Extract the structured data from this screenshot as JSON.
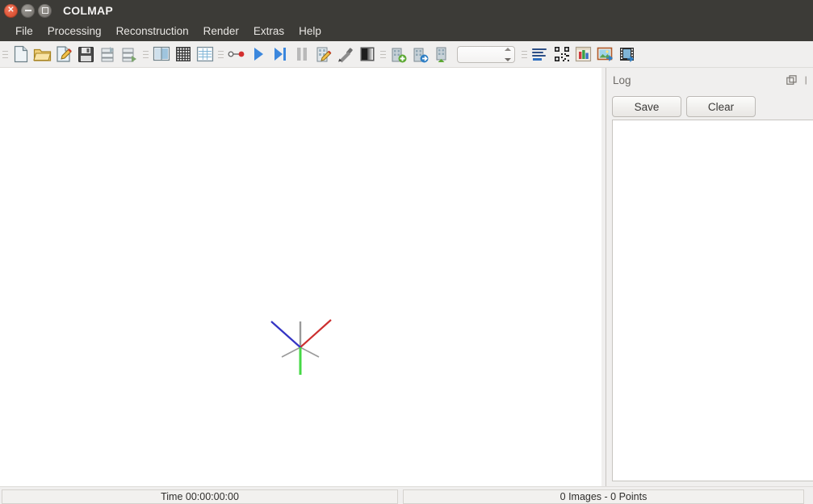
{
  "window": {
    "title": "COLMAP",
    "controls": [
      {
        "name": "close",
        "glyph": "×"
      },
      {
        "name": "minimize",
        "glyph": "−"
      },
      {
        "name": "maximize",
        "glyph": "□"
      }
    ]
  },
  "menubar": {
    "items": [
      {
        "label": "File"
      },
      {
        "label": "Processing"
      },
      {
        "label": "Reconstruction"
      },
      {
        "label": "Render"
      },
      {
        "label": "Extras"
      },
      {
        "label": "Help"
      }
    ]
  },
  "toolbar": {
    "spinbox": {
      "value": "",
      "placeholder": ""
    },
    "groups": [
      {
        "name": "project-group",
        "buttons": [
          {
            "icon": "new-project-icon",
            "tooltip": "New project"
          },
          {
            "icon": "open-project-icon",
            "tooltip": "Open project"
          },
          {
            "icon": "edit-project-icon",
            "tooltip": "Edit project"
          },
          {
            "icon": "save-project-icon",
            "tooltip": "Save project"
          },
          {
            "icon": "import-model-icon",
            "tooltip": "Import model"
          },
          {
            "icon": "export-model-icon",
            "tooltip": "Export model"
          }
        ]
      },
      {
        "name": "feature-group",
        "buttons": [
          {
            "icon": "feature-extraction-icon",
            "tooltip": "Feature extraction"
          },
          {
            "icon": "feature-matching-icon",
            "tooltip": "Feature matching"
          },
          {
            "icon": "database-management-icon",
            "tooltip": "Database management"
          }
        ]
      },
      {
        "name": "reconstruction-group",
        "buttons": [
          {
            "icon": "automatic-reconstruction-icon",
            "tooltip": "Automatic reconstruction"
          },
          {
            "icon": "start-reconstruction-icon",
            "tooltip": "Start reconstruction"
          },
          {
            "icon": "step-reconstruction-icon",
            "tooltip": "Reconstruct next image"
          },
          {
            "icon": "pause-reconstruction-icon",
            "tooltip": "Pause reconstruction"
          },
          {
            "icon": "bundle-adjustment-icon",
            "tooltip": "Bundle adjustment"
          },
          {
            "icon": "dense-reconstruction-icon",
            "tooltip": "Dense reconstruction"
          },
          {
            "icon": "render-options-icon",
            "tooltip": "Render options"
          }
        ]
      },
      {
        "name": "model-group",
        "buttons": [
          {
            "icon": "model-add-icon",
            "tooltip": "Add model"
          },
          {
            "icon": "model-next-icon",
            "tooltip": "Next model"
          },
          {
            "icon": "model-reset-icon",
            "tooltip": "Reset model"
          }
        ]
      },
      {
        "name": "stats-group",
        "buttons": [
          {
            "icon": "model-statistics-icon",
            "tooltip": "Show model statistics"
          },
          {
            "icon": "match-matrix-icon",
            "tooltip": "Show match matrix"
          },
          {
            "icon": "log-chart-icon",
            "tooltip": "Show log statistics"
          },
          {
            "icon": "grab-image-icon",
            "tooltip": "Grab image"
          },
          {
            "icon": "grab-movie-icon",
            "tooltip": "Grab movie"
          }
        ]
      }
    ]
  },
  "viewport": {
    "name": "model-viewer",
    "axes": [
      {
        "label": "x-axis",
        "color": "#cc2222"
      },
      {
        "label": "y-axis",
        "color": "#22cc22"
      },
      {
        "label": "z-axis",
        "color": "#2222cc"
      },
      {
        "label": "grid-axis",
        "color": "#999999"
      }
    ]
  },
  "log_panel": {
    "title": "Log",
    "float_icon": "float-icon",
    "close_icon": "close-icon",
    "save_label": "Save",
    "clear_label": "Clear",
    "content": ""
  },
  "statusbar": {
    "time": "Time 00:00:00:00",
    "counts": "0 Images - 0 Points"
  },
  "colors": {
    "titlebar_bg": "#3c3b37",
    "chrome_bg": "#f0efee",
    "viewport_bg": "#ffffff",
    "close_button": "#e0593b",
    "text_light": "#e8e6e3",
    "text_dark": "#3b3a38"
  }
}
